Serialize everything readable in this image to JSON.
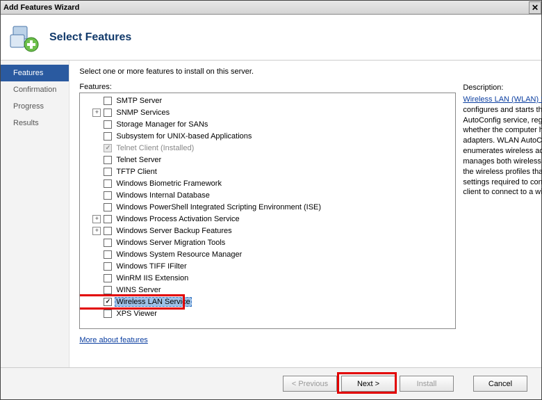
{
  "window_title": "Add Features Wizard",
  "page_heading": "Select Features",
  "sidebar": {
    "steps": [
      {
        "label": "Features",
        "active": true
      },
      {
        "label": "Confirmation",
        "active": false
      },
      {
        "label": "Progress",
        "active": false
      },
      {
        "label": "Results",
        "active": false
      }
    ]
  },
  "main": {
    "instruction": "Select one or more features to install on this server.",
    "features_label": "Features:",
    "description_label": "Description:",
    "more_link": "More about features"
  },
  "features": [
    {
      "label": "SMTP Server",
      "indent": 1,
      "expander": "",
      "checked": false
    },
    {
      "label": "SNMP Services",
      "indent": 1,
      "expander": "+",
      "checked": false
    },
    {
      "label": "Storage Manager for SANs",
      "indent": 1,
      "expander": "",
      "checked": false
    },
    {
      "label": "Subsystem for UNIX-based Applications",
      "indent": 1,
      "expander": "",
      "checked": false
    },
    {
      "label": "Telnet Client  (Installed)",
      "indent": 1,
      "expander": "",
      "checked": true,
      "disabled": true,
      "installed": true
    },
    {
      "label": "Telnet Server",
      "indent": 1,
      "expander": "",
      "checked": false
    },
    {
      "label": "TFTP Client",
      "indent": 1,
      "expander": "",
      "checked": false
    },
    {
      "label": "Windows Biometric Framework",
      "indent": 1,
      "expander": "",
      "checked": false
    },
    {
      "label": "Windows Internal Database",
      "indent": 1,
      "expander": "",
      "checked": false
    },
    {
      "label": "Windows PowerShell Integrated Scripting Environment (ISE)",
      "indent": 1,
      "expander": "",
      "checked": false
    },
    {
      "label": "Windows Process Activation Service",
      "indent": 1,
      "expander": "+",
      "checked": false
    },
    {
      "label": "Windows Server Backup Features",
      "indent": 1,
      "expander": "+",
      "checked": false
    },
    {
      "label": "Windows Server Migration Tools",
      "indent": 1,
      "expander": "",
      "checked": false
    },
    {
      "label": "Windows System Resource Manager",
      "indent": 1,
      "expander": "",
      "checked": false
    },
    {
      "label": "Windows TIFF IFilter",
      "indent": 1,
      "expander": "",
      "checked": false
    },
    {
      "label": "WinRM IIS Extension",
      "indent": 1,
      "expander": "",
      "checked": false
    },
    {
      "label": "WINS Server",
      "indent": 1,
      "expander": "",
      "checked": false
    },
    {
      "label": "Wireless LAN Service",
      "indent": 1,
      "expander": "",
      "checked": true,
      "selected": true
    },
    {
      "label": "XPS Viewer",
      "indent": 1,
      "expander": "",
      "checked": false
    }
  ],
  "description": {
    "link_text": "Wireless LAN (WLAN) Service",
    "body": " configures and starts the WLAN AutoConfig service, regardless of whether the computer has any wireless adapters. WLAN AutoConfig enumerates wireless adapters, and manages both wireless connections and the wireless profiles that contain the settings required to configure a wireless client to connect to a wireless network."
  },
  "buttons": {
    "previous": "< Previous",
    "next": "Next >",
    "install": "Install",
    "cancel": "Cancel"
  }
}
